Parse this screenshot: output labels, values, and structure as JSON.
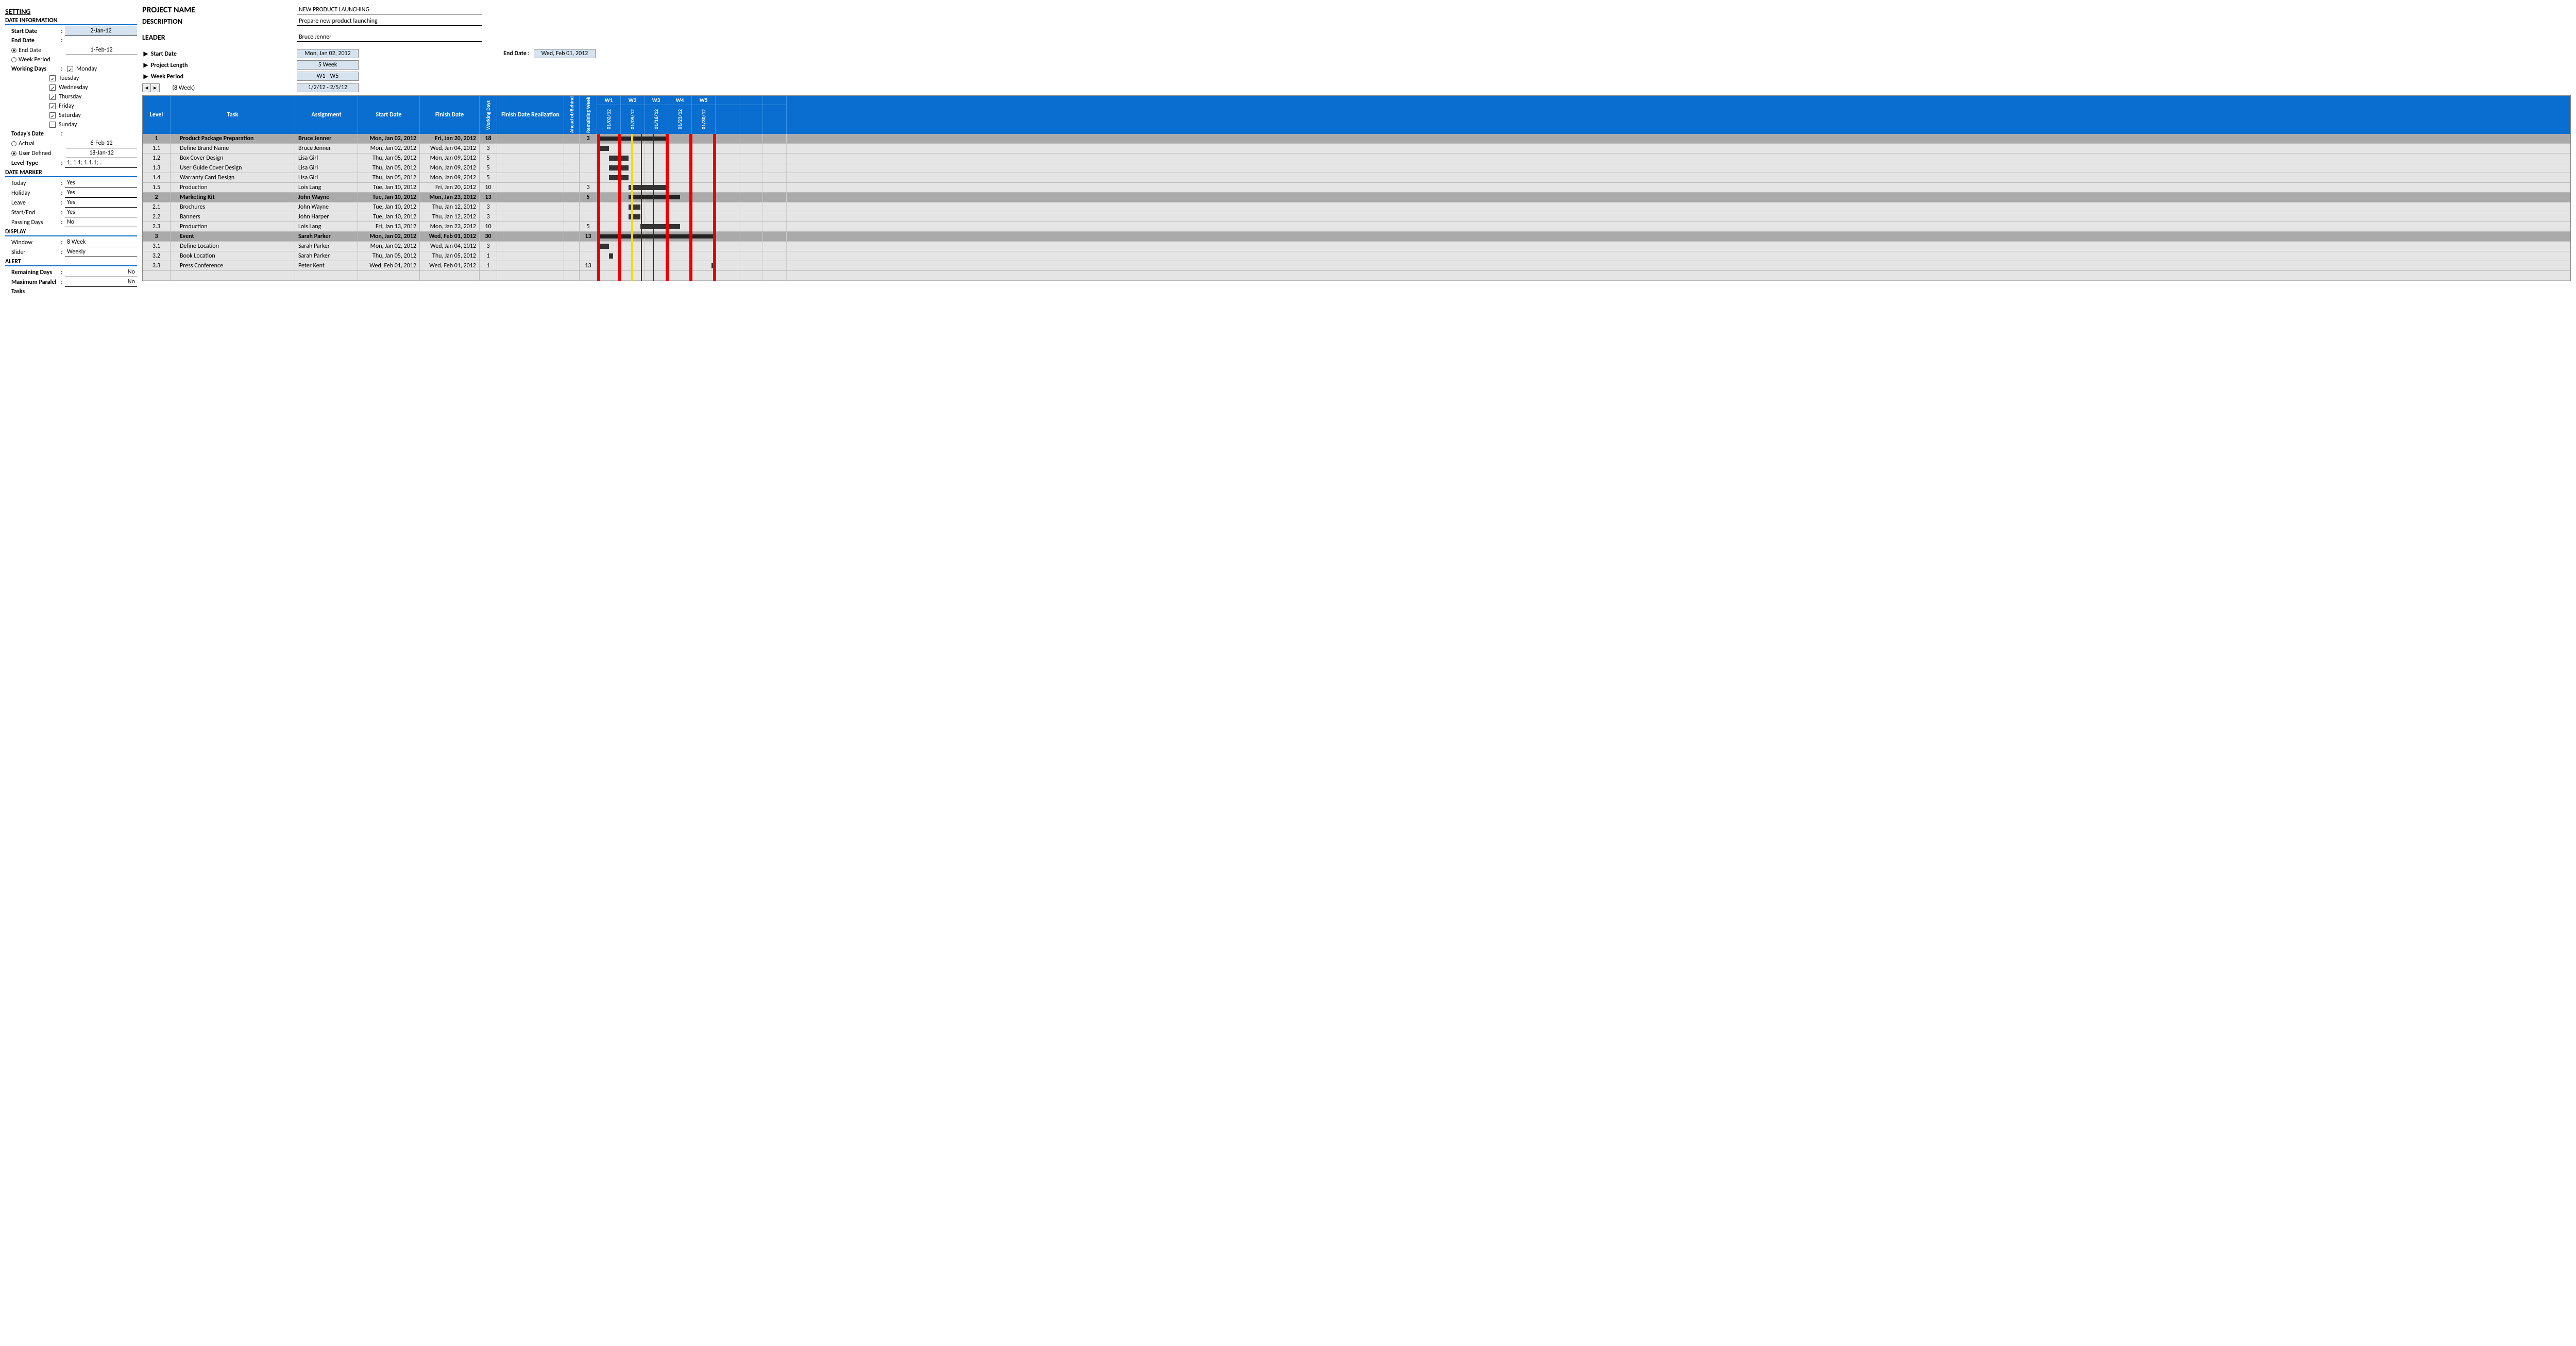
{
  "settings": {
    "title": "SETTING",
    "date_info": {
      "title": "DATE INFORMATION",
      "start_date_label": "Start Date",
      "start_date": "2-Jan-12",
      "end_date_label": "End Date",
      "end_date_radio": "End Date",
      "end_date": "1-Feb-12",
      "week_period_radio": "Week Period",
      "working_days_label": "Working Days",
      "days": [
        "Monday",
        "Tuesday",
        "Wednesday",
        "Thursday",
        "Friday",
        "Saturday",
        "Sunday"
      ],
      "days_checked": [
        true,
        true,
        true,
        true,
        true,
        true,
        false
      ]
    },
    "today": {
      "label": "Today's Date",
      "actual_label": "Actual",
      "actual_val": "6-Feb-12",
      "user_label": "User Defined",
      "user_val": "18-Jan-12"
    },
    "level_type": {
      "label": "Level Type",
      "val": "1; 1.1; 1.1.1; .."
    },
    "date_marker": {
      "title": "DATE MARKER",
      "today": "Today",
      "today_v": "Yes",
      "holiday": "Holiday",
      "holiday_v": "Yes",
      "leave": "Leave",
      "leave_v": "Yes",
      "se": "Start/End",
      "se_v": "Yes",
      "pd": "Passing Days",
      "pd_v": "No"
    },
    "display": {
      "title": "DISPLAY",
      "window": "Window",
      "window_v": "8 Week",
      "slider": "Slider",
      "slider_v": "Weekly"
    },
    "alert": {
      "title": "ALERT",
      "rd": "Remaining Days",
      "rd_v": "No",
      "mp": "Maximum Paralel",
      "mp_v": "No",
      "tasks": "Tasks"
    }
  },
  "project": {
    "name_label": "PROJECT NAME",
    "name": "NEW PRODUCT LAUNCHING",
    "desc_label": "DESCRIPTION",
    "desc": "Prepare new product launching",
    "leader_label": "LEADER",
    "leader": "Bruce Jenner",
    "start_label": "Start Date",
    "start": "Mon, Jan 02, 2012",
    "end_label": "End Date :",
    "end": "Wed, Feb 01, 2012",
    "length_label": "Project Length",
    "length": "5 Week",
    "period_label": "Week Period",
    "period": "W1 - W5",
    "slider_label": "(8 Week)",
    "slider_range": "1/2/12 - 2/5/12"
  },
  "headers": {
    "level": "Level",
    "task": "Task",
    "assign": "Assignment",
    "start": "Start Date",
    "finish": "Finish Date",
    "wd": "Working Days",
    "real": "Finish Date Realization",
    "ahead": "Ahead of/Behind",
    "remain": "Remaining Week",
    "weeks": [
      "W1",
      "W2",
      "W3",
      "W4",
      "W5",
      "",
      "",
      ""
    ],
    "week_dates": [
      "01/02/12",
      "01/09/12",
      "01/16/12",
      "01/23/12",
      "01/30/12",
      "",
      "",
      ""
    ]
  },
  "tasks": [
    {
      "lvl": "1",
      "name": "Product Package Preparation",
      "assign": "Bruce Jenner",
      "start": "Mon, Jan 02, 2012",
      "finish": "Fri, Jan 20, 2012",
      "wd": "18",
      "remain": "3",
      "sum": true,
      "bar": [
        0,
        138
      ]
    },
    {
      "lvl": "1.1",
      "name": "Define Brand Name",
      "assign": "Bruce Jenner",
      "start": "Mon, Jan 02, 2012",
      "finish": "Wed, Jan 04, 2012",
      "wd": "3",
      "remain": "",
      "sum": false,
      "bar": [
        0,
        23
      ]
    },
    {
      "lvl": "1.2",
      "name": "Box Cover Design",
      "assign": "Lisa Girl",
      "start": "Thu, Jan 05, 2012",
      "finish": "Mon, Jan 09, 2012",
      "wd": "5",
      "remain": "",
      "sum": false,
      "bar": [
        23,
        38
      ]
    },
    {
      "lvl": "1.3",
      "name": "User Guide Cover Design",
      "assign": "Lisa Girl",
      "start": "Thu, Jan 05, 2012",
      "finish": "Mon, Jan 09, 2012",
      "wd": "5",
      "remain": "",
      "sum": false,
      "bar": [
        23,
        38
      ]
    },
    {
      "lvl": "1.4",
      "name": "Warranty Card Design",
      "assign": "Lisa Girl",
      "start": "Thu, Jan 05, 2012",
      "finish": "Mon, Jan 09, 2012",
      "wd": "5",
      "remain": "",
      "sum": false,
      "bar": [
        23,
        38
      ]
    },
    {
      "lvl": "1.5",
      "name": "Production",
      "assign": "Lois Lang",
      "start": "Tue, Jan 10, 2012",
      "finish": "Fri, Jan 20, 2012",
      "wd": "10",
      "remain": "3",
      "sum": false,
      "bar": [
        61,
        77
      ]
    },
    {
      "lvl": "2",
      "name": "Marketing Kit",
      "assign": "John Wayne",
      "start": "Tue, Jan 10, 2012",
      "finish": "Mon, Jan 23, 2012",
      "wd": "13",
      "remain": "5",
      "sum": true,
      "bar": [
        61,
        100
      ]
    },
    {
      "lvl": "2.1",
      "name": "Brochures",
      "assign": "John Wayne",
      "start": "Tue, Jan 10, 2012",
      "finish": "Thu, Jan 12, 2012",
      "wd": "3",
      "remain": "",
      "sum": false,
      "bar": [
        61,
        23
      ]
    },
    {
      "lvl": "2.2",
      "name": "Banners",
      "assign": "John Harper",
      "start": "Tue, Jan 10, 2012",
      "finish": "Thu, Jan 12, 2012",
      "wd": "3",
      "remain": "",
      "sum": false,
      "bar": [
        61,
        23
      ]
    },
    {
      "lvl": "2.3",
      "name": "Production",
      "assign": "Lois Lang",
      "start": "Fri, Jan 13, 2012",
      "finish": "Mon, Jan 23, 2012",
      "wd": "10",
      "remain": "5",
      "sum": false,
      "bar": [
        84,
        77
      ]
    },
    {
      "lvl": "3",
      "name": "Event",
      "assign": "Sarah Parker",
      "start": "Mon, Jan 02, 2012",
      "finish": "Wed, Feb 01, 2012",
      "wd": "30",
      "remain": "13",
      "sum": true,
      "bar": [
        0,
        230
      ]
    },
    {
      "lvl": "3.1",
      "name": "Define Location",
      "assign": "Sarah Parker",
      "start": "Mon, Jan 02, 2012",
      "finish": "Wed, Jan 04, 2012",
      "wd": "3",
      "remain": "",
      "sum": false,
      "bar": [
        0,
        23
      ]
    },
    {
      "lvl": "3.2",
      "name": "Book Location",
      "assign": "Sarah Parker",
      "start": "Thu, Jan 05, 2012",
      "finish": "Thu, Jan 05, 2012",
      "wd": "1",
      "remain": "",
      "sum": false,
      "bar": [
        23,
        8
      ]
    },
    {
      "lvl": "3.3",
      "name": "Press Conference",
      "assign": "Peter Kent",
      "start": "Wed, Feb 01, 2012",
      "finish": "Wed, Feb 01, 2012",
      "wd": "1",
      "remain": "13",
      "sum": false,
      "bar": [
        222,
        8
      ]
    }
  ],
  "markers": [
    {
      "pos": 0,
      "cls": ""
    },
    {
      "pos": 41,
      "cls": ""
    },
    {
      "pos": 66,
      "cls": "yellow"
    },
    {
      "pos": 85,
      "cls": "blue"
    },
    {
      "pos": 108,
      "cls": "blue"
    },
    {
      "pos": 133,
      "cls": ""
    },
    {
      "pos": 179,
      "cls": ""
    },
    {
      "pos": 225,
      "cls": ""
    }
  ]
}
